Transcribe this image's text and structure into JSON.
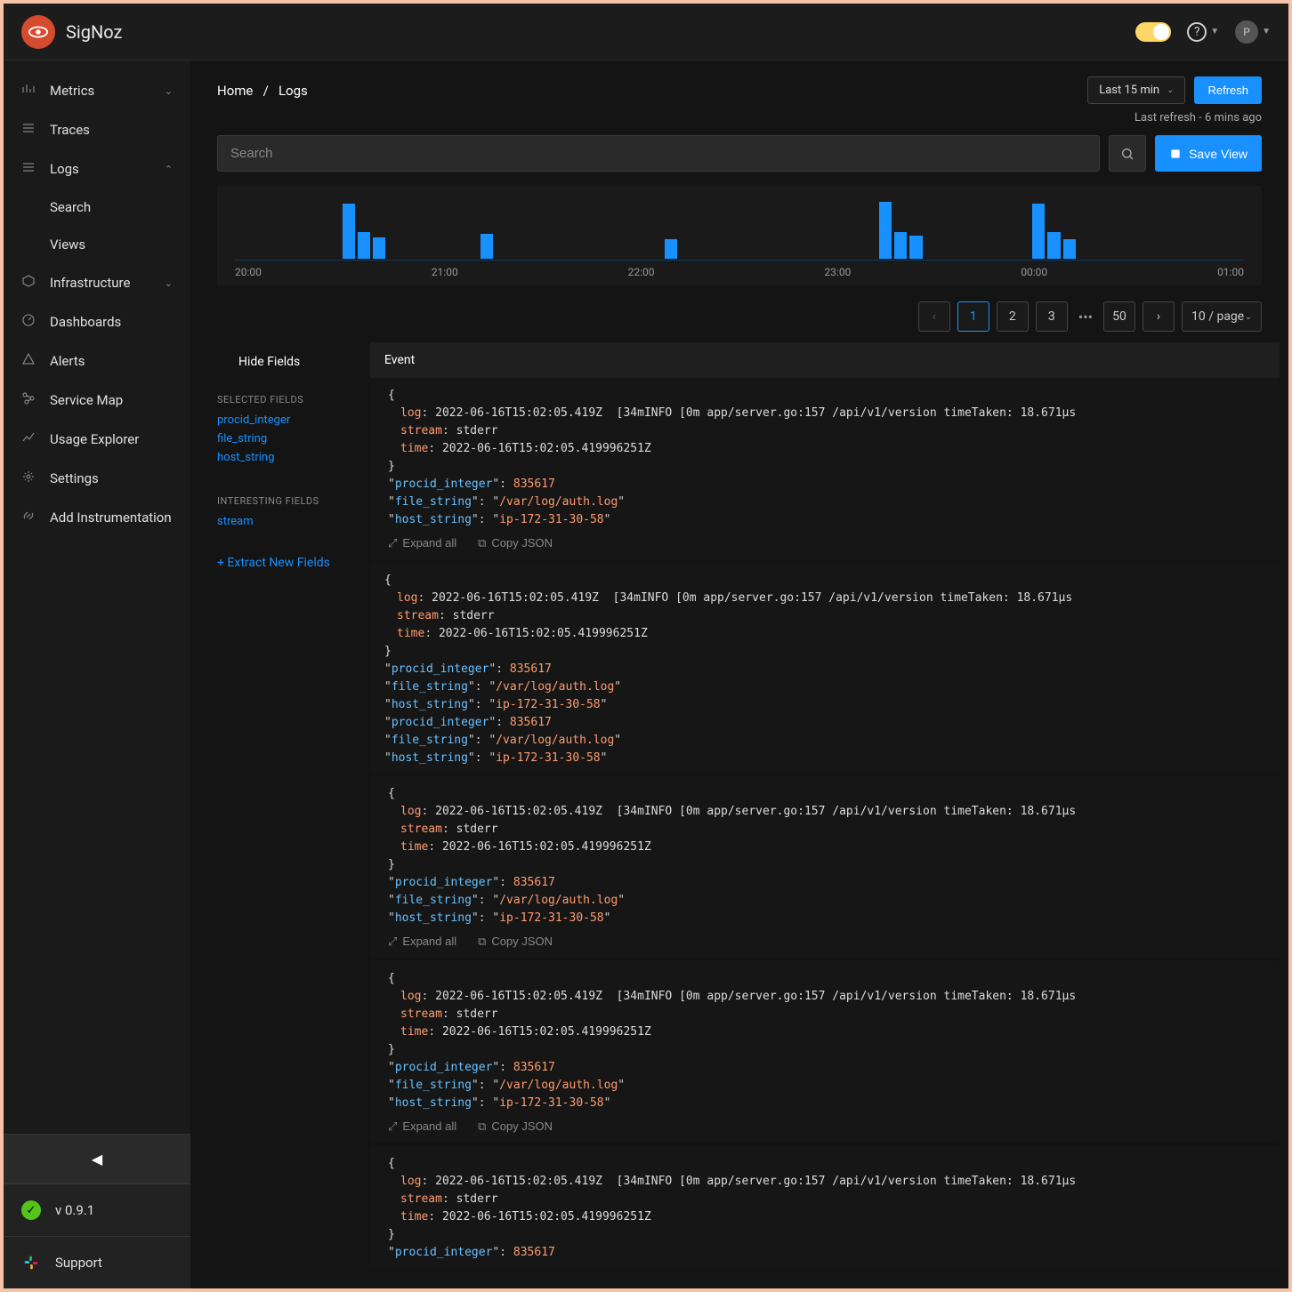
{
  "brand": "SigNoz",
  "header": {
    "avatar_initial": "P",
    "help_label": "?"
  },
  "sidebar": {
    "items": [
      {
        "label": "Metrics",
        "icon": "bars",
        "expandable": true
      },
      {
        "label": "Traces",
        "icon": "menu"
      },
      {
        "label": "Logs",
        "icon": "menu",
        "expanded": true,
        "subs": [
          "Search",
          "Views"
        ]
      },
      {
        "label": "Infrastructure",
        "icon": "cube",
        "expandable": true
      },
      {
        "label": "Dashboards",
        "icon": "gauge"
      },
      {
        "label": "Alerts",
        "icon": "alert"
      },
      {
        "label": "Service Map",
        "icon": "map"
      },
      {
        "label": "Usage Explorer",
        "icon": "usage"
      },
      {
        "label": "Settings",
        "icon": "gear"
      },
      {
        "label": "Add Instrumentation",
        "icon": "link"
      }
    ],
    "version": "v 0.9.1",
    "support": "Support"
  },
  "breadcrumb": {
    "home": "Home",
    "sep": "/",
    "page": "Logs"
  },
  "timerange": "Last 15 min",
  "refresh": "Refresh",
  "last_refresh": "Last refresh - 6 mins ago",
  "search_placeholder": "Search",
  "save_view": "Save View",
  "chart_data": {
    "type": "bar",
    "xlabel": "",
    "ylabel": "",
    "categories": [
      "20:00",
      "21:00",
      "22:00",
      "23:00",
      "00:00",
      "01:00"
    ],
    "bars": [
      0,
      0,
      0,
      0,
      0,
      0,
      0,
      62,
      30,
      24,
      0,
      0,
      0,
      0,
      0,
      0,
      28,
      0,
      0,
      0,
      0,
      0,
      0,
      0,
      0,
      0,
      0,
      0,
      22,
      0,
      0,
      0,
      0,
      0,
      0,
      0,
      0,
      0,
      0,
      0,
      0,
      0,
      64,
      30,
      26,
      0,
      0,
      0,
      0,
      0,
      0,
      0,
      62,
      30,
      22,
      0,
      0,
      0,
      0,
      0,
      0,
      0,
      0,
      0,
      0,
      0
    ]
  },
  "pagination": {
    "pages": [
      "1",
      "2",
      "3"
    ],
    "last": "50",
    "size": "10 / page",
    "ellipsis": "•••"
  },
  "fields": {
    "hide": "Hide Fields",
    "selected_header": "SELECTED FIELDS",
    "selected": [
      "procid_integer",
      "file_string",
      "host_string"
    ],
    "interesting_header": "INTERESTING  FIELDS",
    "interesting": [
      "stream"
    ],
    "extract": "+ Extract New Fields"
  },
  "events_header": "Event",
  "log_common": {
    "log_key": "log",
    "log_val": "2022-06-16T15:02:05.419Z  [34mINFO [0m app/server.go:157 /api/v1/version timeTaken: 18.671µs",
    "stream_key": "stream",
    "stream_val": "stderr",
    "time_key": "time",
    "time_val": "2022-06-16T15:02:05.419996251Z",
    "procid_key": "procid_integer",
    "procid_val": "835617",
    "file_key": "file_string",
    "file_val": "/var/log/auth.log",
    "host_key": "host_string",
    "host_val": "ip-172-31-30-58",
    "expand": "Expand all",
    "copy": "Copy JSON"
  }
}
